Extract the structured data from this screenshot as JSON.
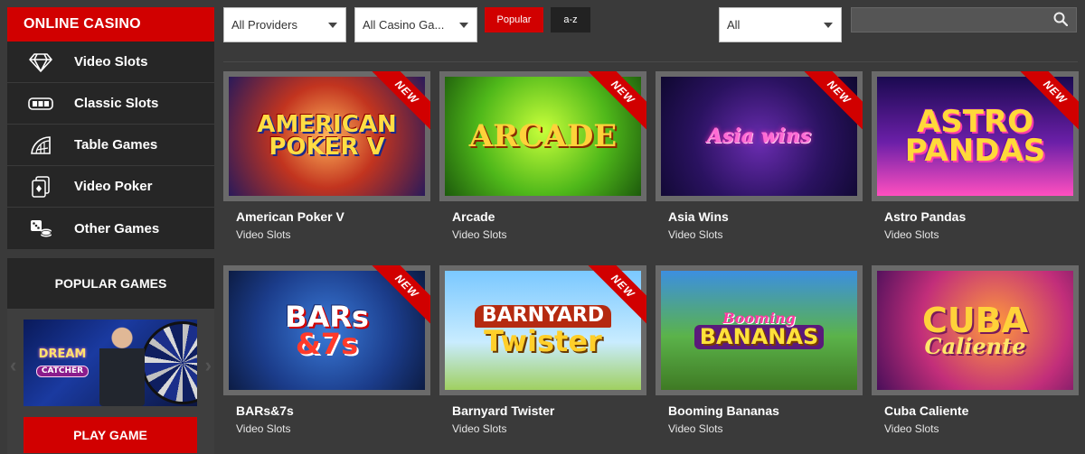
{
  "sidebar": {
    "header": "ONLINE CASINO",
    "items": [
      {
        "label": "Video Slots",
        "icon": "diamond-icon"
      },
      {
        "label": "Classic Slots",
        "icon": "slot-reels-icon"
      },
      {
        "label": "Table Games",
        "icon": "roulette-table-icon"
      },
      {
        "label": "Video Poker",
        "icon": "playing-cards-icon"
      },
      {
        "label": "Other Games",
        "icon": "dice-chips-icon"
      }
    ],
    "popular": {
      "title": "POPULAR GAMES",
      "featured": {
        "logo_line1": "DREAM",
        "logo_line2": "CATCHER"
      },
      "play_label": "PLAY GAME"
    }
  },
  "toolbar": {
    "providers": "All Providers",
    "categories": "All Casino Ga...",
    "sort_popular": "Popular",
    "sort_az": "a-z",
    "filter": "All",
    "search_placeholder": ""
  },
  "colors": {
    "accent": "#d10000",
    "background": "#3a3a3a",
    "panel": "#262626"
  },
  "badge_new": "NEW",
  "games": [
    {
      "name": "American Poker V",
      "category": "Video Slots",
      "is_new": true,
      "logo": [
        "AMERICAN",
        "POKER V"
      ]
    },
    {
      "name": "Arcade",
      "category": "Video Slots",
      "is_new": true,
      "logo": [
        "ARCADE"
      ]
    },
    {
      "name": "Asia Wins",
      "category": "Video Slots",
      "is_new": true,
      "logo": [
        "Asia wins"
      ]
    },
    {
      "name": "Astro Pandas",
      "category": "Video Slots",
      "is_new": true,
      "logo": [
        "ASTRO",
        "PANDAS"
      ]
    },
    {
      "name": "BARs&7s",
      "category": "Video Slots",
      "is_new": true,
      "logo": [
        "BARs",
        "&7s"
      ]
    },
    {
      "name": "Barnyard Twister",
      "category": "Video Slots",
      "is_new": true,
      "logo": [
        "BARNYARD",
        "Twister"
      ]
    },
    {
      "name": "Booming Bananas",
      "category": "Video Slots",
      "is_new": false,
      "logo": [
        "Booming",
        "BANANAS"
      ]
    },
    {
      "name": "Cuba Caliente",
      "category": "Video Slots",
      "is_new": false,
      "logo": [
        "CUBA",
        "Caliente"
      ]
    }
  ]
}
